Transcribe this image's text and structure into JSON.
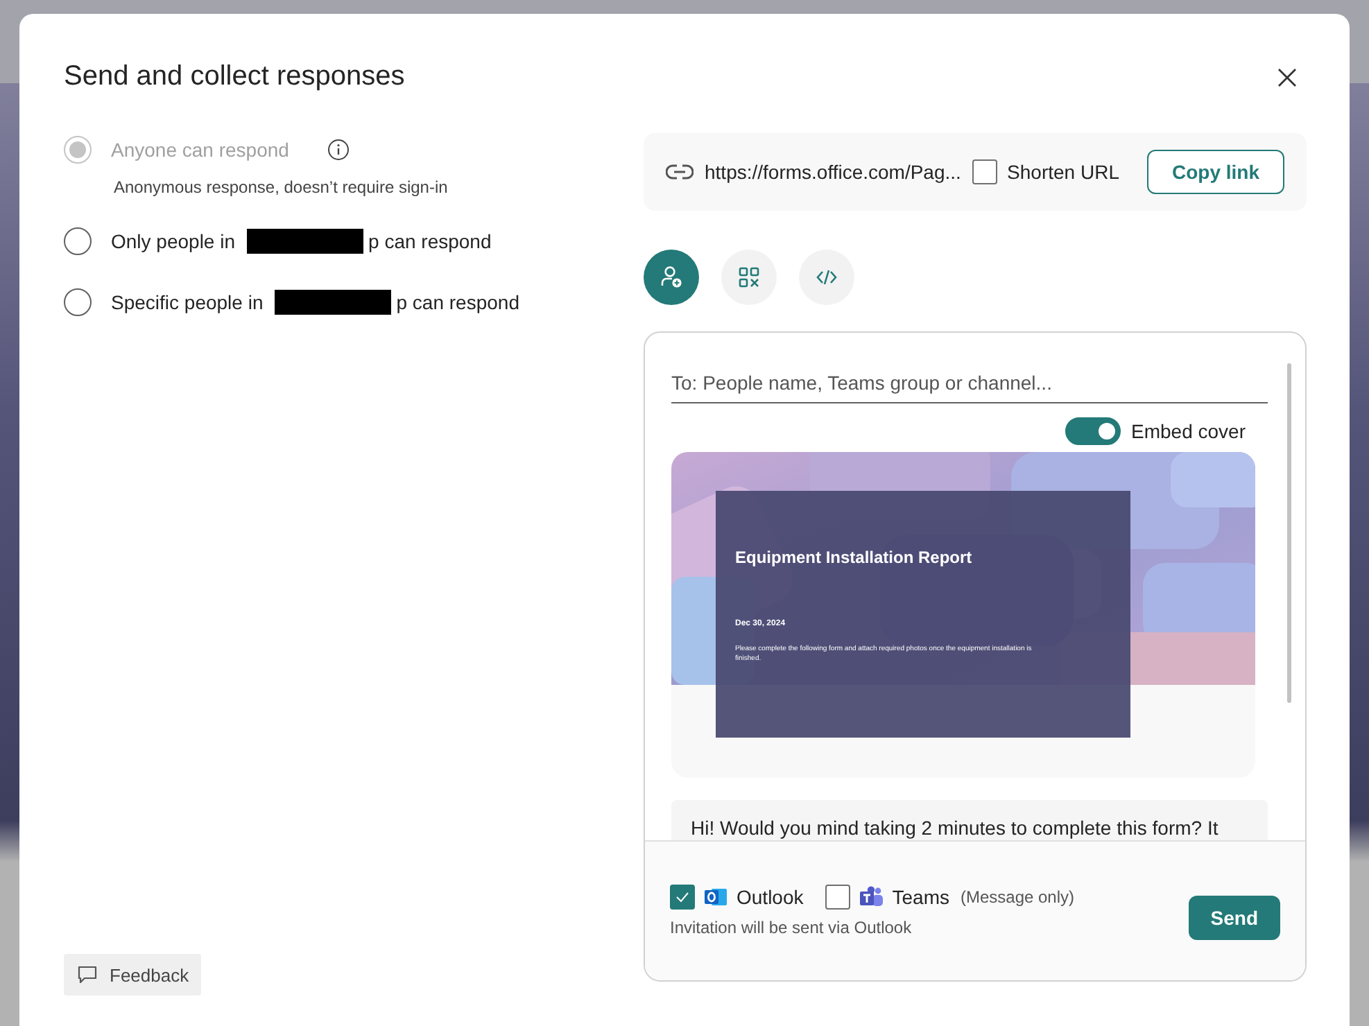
{
  "dialog": {
    "title": "Send and collect responses"
  },
  "audience": [
    {
      "label": "Anyone can respond",
      "selected": true,
      "disabled": true,
      "has_info": true,
      "description": "Anonymous response, doesn’t require sign-in"
    },
    {
      "label": "Only people in",
      "label_after": "p can respond",
      "selected": false,
      "disabled": false,
      "has_info": false
    },
    {
      "label": "Specific people in",
      "label_after": "p can respond",
      "selected": false,
      "disabled": false,
      "has_info": false
    }
  ],
  "link": {
    "url": "https://forms.office.com/Pag...",
    "shorten_url": {
      "label": "Shorten URL",
      "checked": false
    },
    "copy_button": "Copy link"
  },
  "share_modes": [
    {
      "kind": "people",
      "selected": true
    },
    {
      "kind": "qr",
      "selected": false
    },
    {
      "kind": "embed",
      "selected": false
    }
  ],
  "invite": {
    "to_placeholder": "To: People name, Teams group or channel...",
    "embed_cover": {
      "label": "Embed cover",
      "on": true
    },
    "cover": {
      "title": "Equipment Installation Report",
      "date": "Dec 30, 2024",
      "description": "Please complete the following form and attach required photos once the equipment installation is finished."
    },
    "message": "Hi! Would you mind taking 2 minutes to complete this form? It",
    "channels": [
      {
        "kind": "outlook",
        "label": "Outlook",
        "checked": true
      },
      {
        "kind": "teams",
        "label": "Teams",
        "note": "(Message only)",
        "checked": false
      }
    ],
    "hint": "Invitation will be sent via Outlook",
    "send_button": "Send"
  },
  "feedback_button": "Feedback"
}
